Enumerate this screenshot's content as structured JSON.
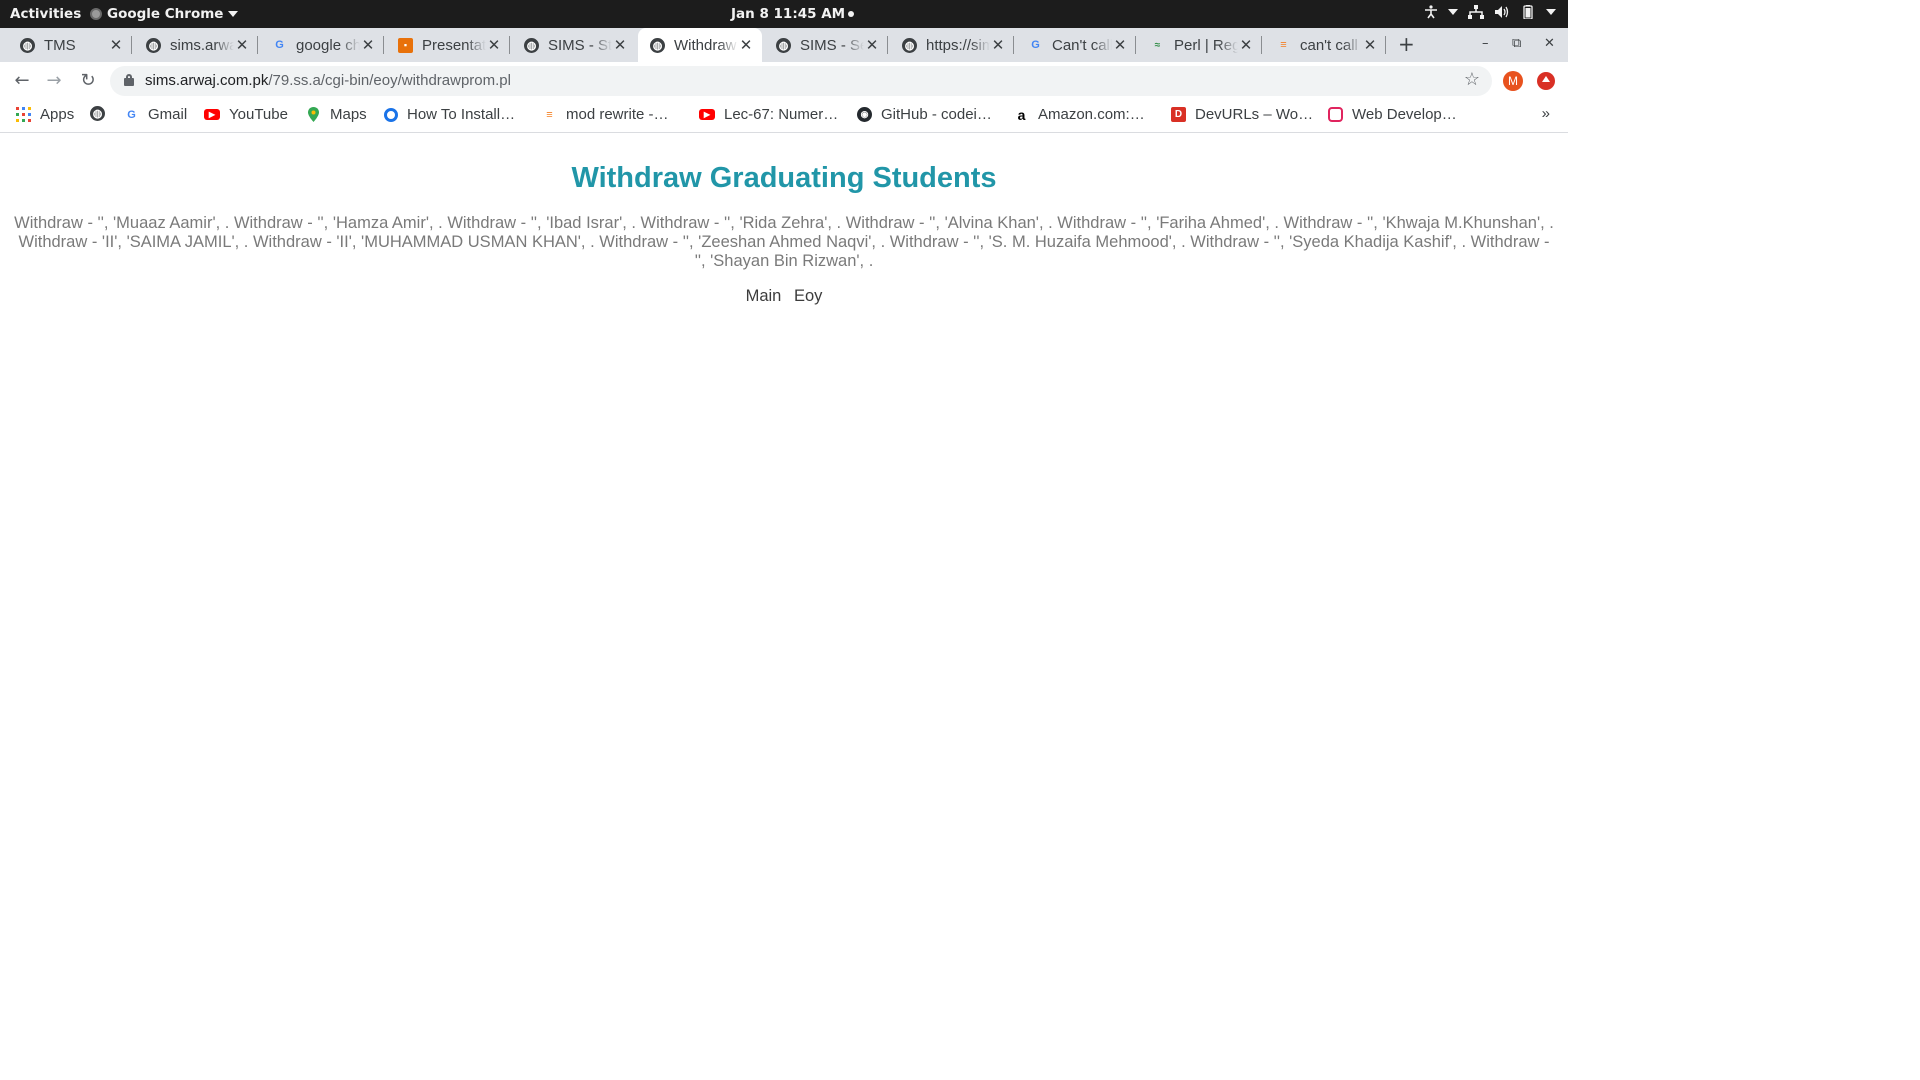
{
  "system_bar": {
    "activities": "Activities",
    "app_name": "Google Chrome",
    "clock": "Jan 8  11:45 AM"
  },
  "tabs": [
    {
      "title": "TMS",
      "favicon": "globe-icon"
    },
    {
      "title": "sims.arwaj",
      "favicon": "globe-icon"
    },
    {
      "title": "google chrome",
      "favicon": "google-icon"
    },
    {
      "title": "Presentation",
      "favicon": "slides-icon"
    },
    {
      "title": "SIMS - Students",
      "favicon": "globe-icon"
    },
    {
      "title": "Withdraw Graduating",
      "favicon": "globe-icon",
      "active": true
    },
    {
      "title": "SIMS - Search",
      "favicon": "globe-icon"
    },
    {
      "title": "https://sims",
      "favicon": "globe-icon"
    },
    {
      "title": "Can't call",
      "favicon": "google-icon"
    },
    {
      "title": "Perl | Regex",
      "favicon": "perl-icon"
    },
    {
      "title": "can't call",
      "favicon": "stackoverflow-icon"
    }
  ],
  "omnibox": {
    "host": "sims.arwaj.com.pk",
    "path": "/79.ss.a/cgi-bin/eoy/withdrawprom.pl"
  },
  "profile": {
    "initial": "M"
  },
  "bookmarks": [
    {
      "label": "Apps",
      "icon": "apps-grid-icon"
    },
    {
      "label": "",
      "icon": "globe-icon"
    },
    {
      "label": "Gmail",
      "icon": "google-icon"
    },
    {
      "label": "YouTube",
      "icon": "youtube-icon"
    },
    {
      "label": "Maps",
      "icon": "maps-pin-icon"
    },
    {
      "label": "How To Install…",
      "icon": "digitalocean-icon"
    },
    {
      "label": "mod rewrite -…",
      "icon": "stackoverflow-icon"
    },
    {
      "label": "Lec-67: Numer…",
      "icon": "youtube-icon"
    },
    {
      "label": "GitHub - codei…",
      "icon": "github-icon"
    },
    {
      "label": "Amazon.com:…",
      "icon": "amazon-icon"
    },
    {
      "label": "DevURLs – Wo…",
      "icon": "devurls-icon"
    },
    {
      "label": "Web Develop…",
      "icon": "webdev-icon"
    }
  ],
  "page": {
    "title": "Withdraw Graduating Students",
    "withdraw_text": "Withdraw - '', 'Muaaz Aamir', . Withdraw - '', 'Hamza Amir', . Withdraw - '', 'Ibad Israr', . Withdraw - '', 'Rida Zehra', . Withdraw - '', 'Alvina Khan', . Withdraw - '', 'Fariha Ahmed', . Withdraw - '', 'Khwaja M.Khunshan', . Withdraw - 'II', 'SAIMA JAMIL', . Withdraw - 'II', 'MUHAMMAD USMAN KHAN', . Withdraw - '', 'Zeeshan Ahmed Naqvi', . Withdraw - '', 'S. M. Huzaifa Mehmood', . Withdraw - '', 'Syeda Khadija Kashif', . Withdraw - '', 'Shayan Bin Rizwan', .",
    "nav_links": [
      "Main",
      "Eoy"
    ]
  },
  "colors": {
    "title": "#2196a8",
    "body_text": "#7a7a7a",
    "tab_strip": "#dee1e6",
    "system_bar": "#1c1c1c"
  }
}
